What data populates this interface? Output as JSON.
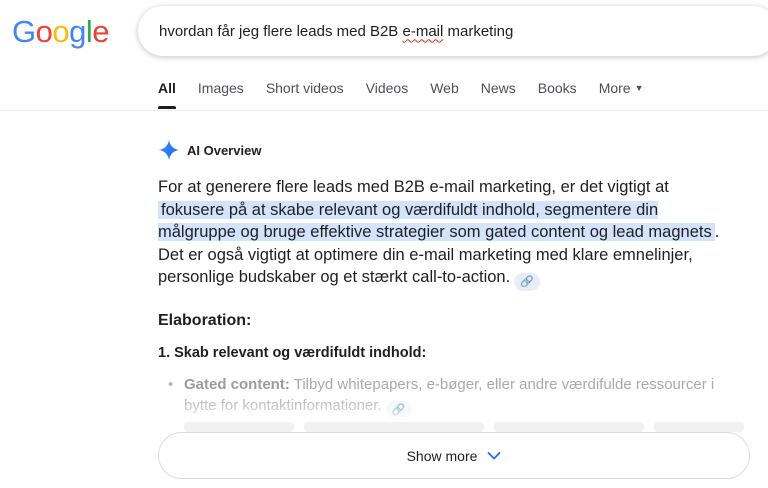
{
  "logo": {
    "letters": [
      "G",
      "o",
      "o",
      "g",
      "l",
      "e"
    ],
    "colors": [
      "#4285F4",
      "#EA4335",
      "#FBBC05",
      "#4285F4",
      "#34A853",
      "#EA4335"
    ]
  },
  "search": {
    "query_before": "hvordan får jeg flere leads med B2B ",
    "query_flagged": "e-mail",
    "query_after": " marketing"
  },
  "tabs": [
    {
      "label": "All",
      "active": true
    },
    {
      "label": "Images"
    },
    {
      "label": "Short videos"
    },
    {
      "label": "Videos"
    },
    {
      "label": "Web"
    },
    {
      "label": "News"
    },
    {
      "label": "Books"
    },
    {
      "label": "More",
      "icon": "caret-down-icon"
    }
  ],
  "ai_overview": {
    "label": "AI Overview",
    "icon": "gemini-sparkle-icon",
    "text_intro": "For at generere flere leads med B2B e-mail marketing, er det vigtigt at ",
    "text_highlight": "fokusere på at skabe relevant og værdifuldt indhold, segmentere din målgruppe og bruge effektive strategier som gated content og lead magnets",
    "text_rest": ". Det er også vigtigt at optimere din e-mail marketing med klare emnelinjer, personlige budskaber og et stærkt call-to-action.",
    "link_icon": "link-icon",
    "elaboration_heading": "Elaboration:",
    "section_1_title": "1. Skab relevant og værdifuldt indhold:",
    "bullet_1_bold": "Gated content:",
    "bullet_1_text": " Tilbyd whitepapers, e-bøger, eller andre værdifulde ressourcer i bytte for kontaktinformationer."
  },
  "show_more": {
    "label": "Show more",
    "icon": "chevron-down-icon"
  },
  "colors": {
    "accent": "#4285F4",
    "highlight": "#d3e3fd",
    "text": "#1f1f1f",
    "muted": "#4d5156"
  }
}
